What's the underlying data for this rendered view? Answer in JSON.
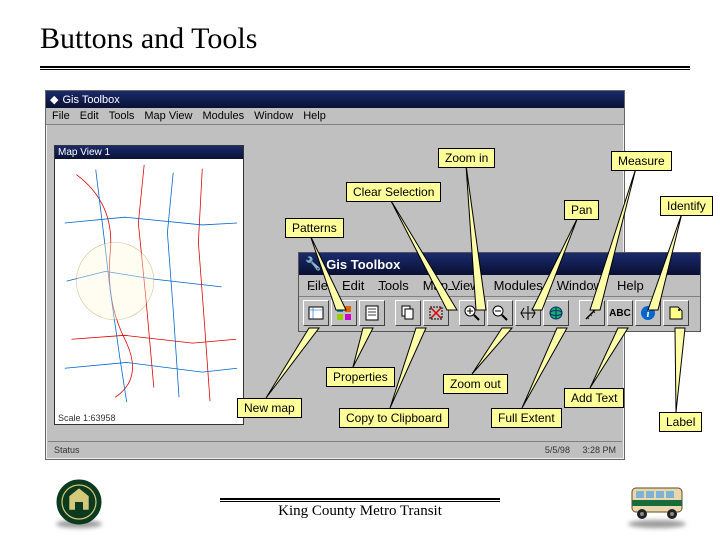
{
  "slide": {
    "title": "Buttons and Tools",
    "footer": "King County Metro Transit"
  },
  "mainWindow": {
    "title": "Gis Toolbox",
    "menu": [
      "File",
      "Edit",
      "Tools",
      "Map View",
      "Modules",
      "Window",
      "Help"
    ],
    "mapPane": {
      "title": "Map View 1",
      "scale": "Scale 1:63958"
    },
    "status": {
      "label": "Status",
      "date": "5/5/98",
      "time": "3:28 PM"
    }
  },
  "zoomWindow": {
    "title": "Gis Toolbox",
    "menu": [
      "File",
      "Edit",
      "Tools",
      "Map View",
      "Modules",
      "Window",
      "Help"
    ]
  },
  "callouts": {
    "zoomIn": "Zoom in",
    "measure": "Measure",
    "clearSelection": "Clear Selection",
    "identify": "Identify",
    "pan": "Pan",
    "patterns": "Patterns",
    "properties": "Properties",
    "zoomOut": "Zoom out",
    "addText": "Add Text",
    "newMap": "New map",
    "copyToClipboard": "Copy to Clipboard",
    "fullExtent": "Full Extent",
    "label": "Label"
  }
}
